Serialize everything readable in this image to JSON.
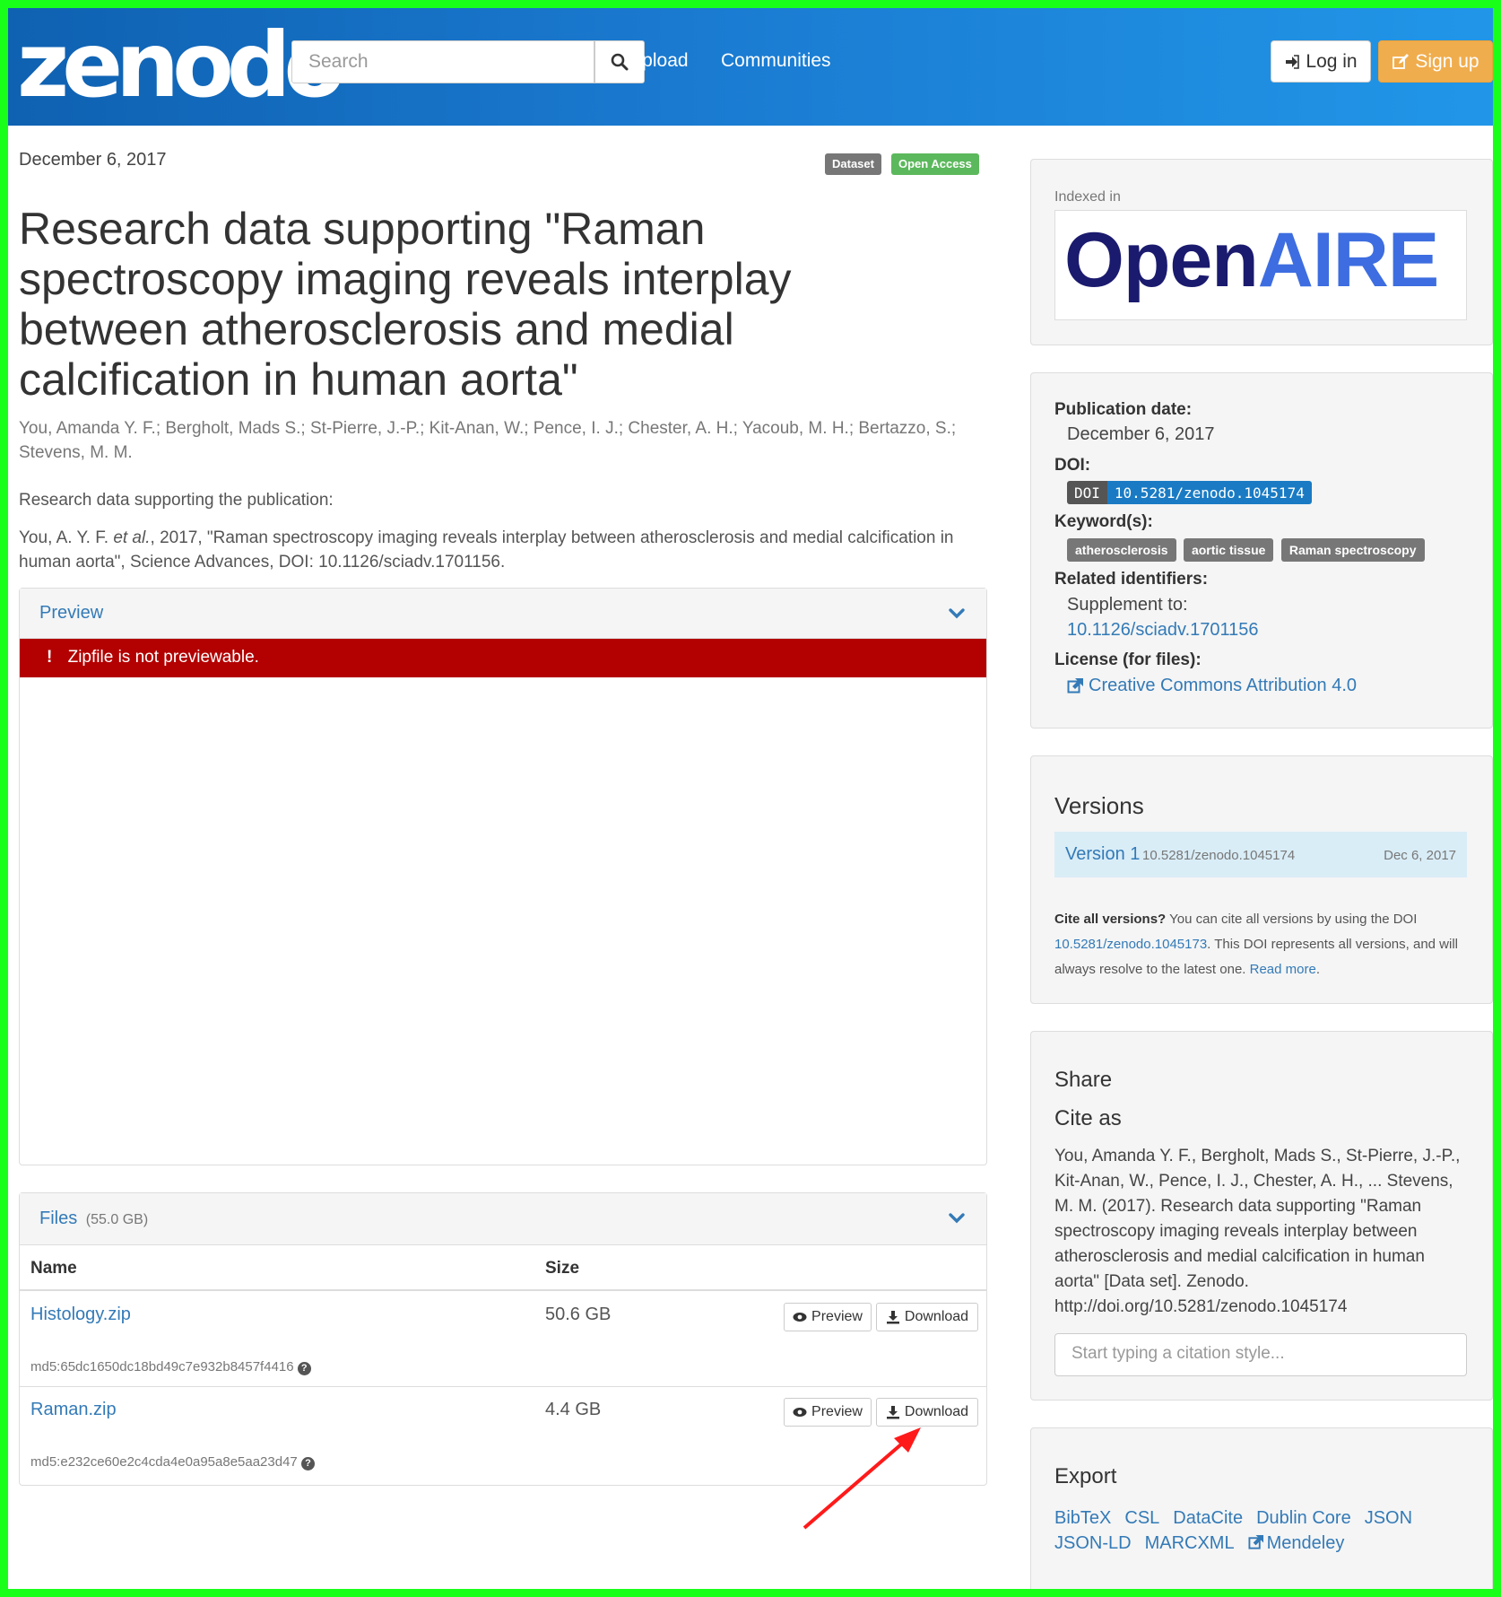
{
  "header": {
    "logo": "zenodo",
    "search_placeholder": "Search",
    "nav": [
      "Upload",
      "Communities"
    ],
    "login": "Log in",
    "signup": "Sign up"
  },
  "record": {
    "date": "December 6, 2017",
    "badges": [
      "Dataset",
      "Open Access"
    ],
    "title": "Research data supporting \"Raman spectroscopy imaging reveals interplay between atherosclerosis and medial calcification in human aorta\"",
    "authors": "You, Amanda Y. F.; Bergholt, Mads S.; St-Pierre, J.-P.; Kit-Anan, W.; Pence, I. J.; Chester, A. H.; Yacoub, M. H.; Bertazzo, S.; Stevens, M. M.",
    "description": "Research data supporting the publication:",
    "citation_prefix": "You, A. Y.  F. ",
    "citation_etal": "et al.",
    "citation_rest": ", 2017, \"Raman spectroscopy imaging reveals interplay between atherosclerosis and medial calcification in human aorta\", Science Advances, DOI: 10.1126/sciadv.1701156."
  },
  "preview": {
    "label": "Preview",
    "alert": "Zipfile is not previewable."
  },
  "files": {
    "label": "Files",
    "size_total": "(55.0 GB)",
    "col_name": "Name",
    "col_size": "Size",
    "preview_btn": "Preview",
    "download_btn": "Download",
    "rows": [
      {
        "name": "Histology.zip",
        "size": "50.6 GB",
        "md5": "md5:65dc1650dc18bd49c7e932b8457f4416"
      },
      {
        "name": "Raman.zip",
        "size": "4.4 GB",
        "md5": "md5:e232ce60e2c4cda4e0a95a8e5aa23d47"
      }
    ]
  },
  "sidebar": {
    "indexed_in": "Indexed in",
    "openaire_open": "Open",
    "openaire_aire": "AIRE",
    "pub_date_label": "Publication date:",
    "pub_date": "December 6, 2017",
    "doi_label": "DOI:",
    "doi_tag": "DOI",
    "doi": "10.5281/zenodo.1045174",
    "keywords_label": "Keyword(s):",
    "keywords": [
      "atherosclerosis",
      "aortic tissue",
      "Raman spectroscopy"
    ],
    "related_label": "Related identifiers:",
    "supplement_to": "Supplement to:",
    "related_doi": "10.1126/sciadv.1701156",
    "license_label": "License (for files):",
    "license": "Creative Commons Attribution 4.0",
    "versions_title": "Versions",
    "version_label": "Version 1",
    "version_doi": "10.5281/zenodo.1045174",
    "version_date": "Dec 6, 2017",
    "cite_all_bold": "Cite all versions?",
    "cite_all_text1": " You can cite all versions by using the DOI ",
    "cite_all_doi": "10.5281/zenodo.1045173",
    "cite_all_text2": ". This DOI represents all versions, and will always resolve to the latest one. ",
    "read_more": "Read more",
    "share_title": "Share",
    "cite_as_title": "Cite as",
    "cite_as_text": "You, Amanda Y. F., Bergholt, Mads S., St-Pierre, J.-P., Kit-Anan, W., Pence, I. J., Chester, A. H., ... Stevens, M. M. (2017). Research data supporting \"Raman spectroscopy imaging reveals interplay between atherosclerosis and medial calcification in human aorta\" [Data set]. Zenodo. http://doi.org/10.5281/zenodo.1045174",
    "citation_style_placeholder": "Start typing a citation style...",
    "export_title": "Export",
    "export_links": [
      "BibTeX",
      "CSL",
      "DataCite",
      "Dublin Core",
      "JSON",
      "JSON-LD",
      "MARCXML",
      "Mendeley"
    ]
  },
  "colors": {
    "header_start": "#0f61b1",
    "header_end": "#2196e8",
    "signup": "#f0ad4e",
    "dataset_badge": "#777777",
    "open_access_badge": "#5cb85c",
    "alert": "#b30000",
    "link": "#337ab7",
    "frame": "#1aff1a",
    "annotation_arrow": "#ff1a1a"
  }
}
